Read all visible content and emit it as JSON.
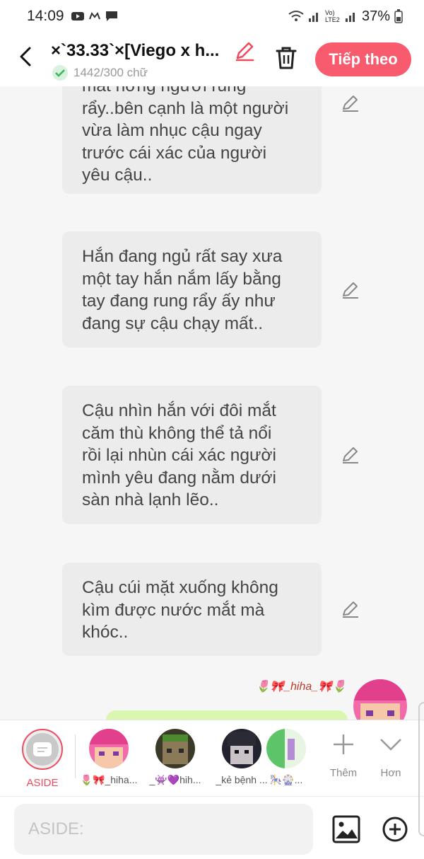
{
  "status_bar": {
    "time": "14:09",
    "battery": "37%",
    "net_label": "Vo) LTE2"
  },
  "header": {
    "title": "×`33.33`×[Viego x h...",
    "word_count": "1442/300 chữ",
    "next_label": "Tiếp theo"
  },
  "messages": [
    {
      "text": "mất hỡng người rung\nrẩy..bên cạnh là một người\nvừa làm nhục cậu ngay\ntrước cái xác của người\nyêu cậu.."
    },
    {
      "text": "Hắn đang ngủ rất say xưa\nmột tay hắn nắm lấy bằng\ntay đang rung rẩy ấy như\nđang sự cậu chạy mất.."
    },
    {
      "text": "Cậu nhìn hắn với đôi mắt\ncăm thù không thể tả nổi\nrồi lại nhùn cái xác người\nmình yêu đang nằm dưới\nsàn nhà lạnh lẽo.."
    },
    {
      "text": "Cậu cúi mặt xuống không\nkìm được nước mắt mà\nkhóc.."
    }
  ],
  "my_sender": "🌷🎀_hiha_🎀🌷",
  "characters": [
    {
      "label": "ASIDE",
      "type": "aside"
    },
    {
      "label": "🌷🎀_hiha...",
      "color": "pink"
    },
    {
      "label": "_👾💜hih...",
      "color": "green"
    },
    {
      "label": "_kẻ bệnh ...",
      "color": "dark"
    },
    {
      "label": "🎠🎡...",
      "color": "mint"
    }
  ],
  "tools": {
    "add_label": "Thêm",
    "more_label": "Hơn"
  },
  "input": {
    "placeholder": "ASIDE:"
  },
  "colors": {
    "accent": "#f85a6e",
    "bubble": "#ececec",
    "my_bubble": "#d9f7b0"
  }
}
